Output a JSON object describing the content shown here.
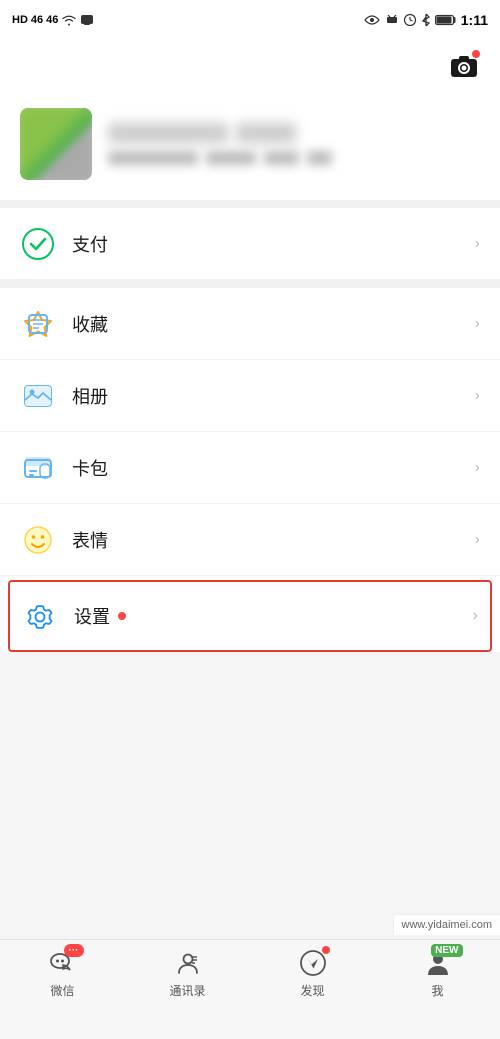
{
  "statusBar": {
    "carrier1": "HD",
    "carrier2": "46",
    "carrier3": "46",
    "time": "1:11",
    "icons": [
      "eye",
      "notification",
      "clock",
      "bluetooth",
      "battery"
    ]
  },
  "profile": {
    "nameBlur1Width": "120px",
    "nameBlur2Width": "80px",
    "meta1Width": "100px",
    "meta2Width": "60px",
    "meta3Width": "40px"
  },
  "menuItems": [
    {
      "id": "payment",
      "label": "支付",
      "iconType": "payment",
      "highlight": false
    },
    {
      "id": "favorites",
      "label": "收藏",
      "iconType": "favorites",
      "highlight": false
    },
    {
      "id": "album",
      "label": "相册",
      "iconType": "album",
      "highlight": false
    },
    {
      "id": "card",
      "label": "卡包",
      "iconType": "card",
      "highlight": false
    },
    {
      "id": "emoji",
      "label": "表情",
      "iconType": "emoji",
      "highlight": false
    },
    {
      "id": "settings",
      "label": "设置",
      "iconType": "settings",
      "dot": true,
      "highlight": true
    }
  ],
  "tabBar": {
    "tabs": [
      {
        "id": "wechat",
        "label": "微信",
        "badge": "..."
      },
      {
        "id": "contacts",
        "label": "通讯录",
        "badge": null
      },
      {
        "id": "discover",
        "label": "发现",
        "badgeDot": true
      },
      {
        "id": "me",
        "label": "我",
        "badgeNew": "NEW"
      }
    ]
  },
  "watermark": "www.yidaimei.com"
}
